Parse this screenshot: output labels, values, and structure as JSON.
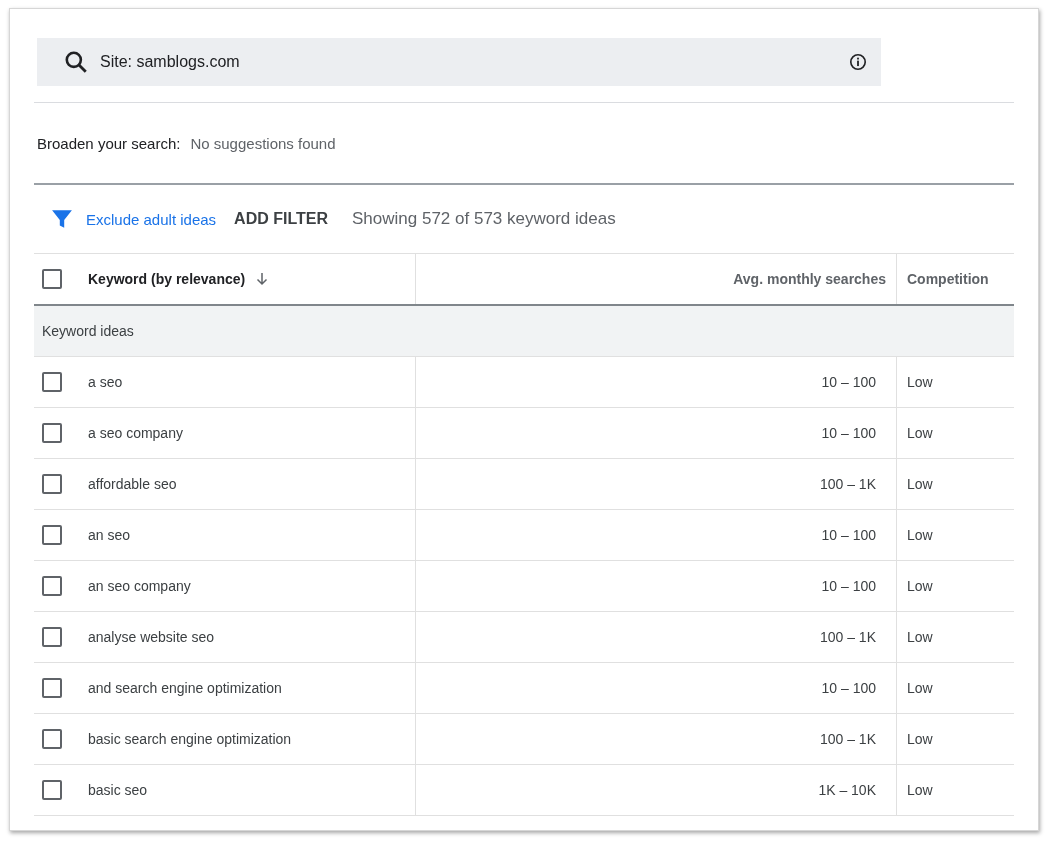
{
  "search": {
    "value": "Site: samblogs.com"
  },
  "broaden": {
    "label": "Broaden your search:",
    "value": "No suggestions found"
  },
  "filter_bar": {
    "exclude_link": "Exclude adult ideas",
    "add_filter": "ADD FILTER",
    "summary": "Showing 572 of 573 keyword ideas"
  },
  "table": {
    "select_all": {
      "checked": false
    },
    "columns": [
      "Keyword (by relevance)",
      "Avg. monthly searches",
      "Competition"
    ],
    "group": "Keyword ideas",
    "rows": [
      {
        "keyword": "a seo",
        "searches": "10 – 100",
        "competition": "Low",
        "checked": false
      },
      {
        "keyword": "a seo company",
        "searches": "10 – 100",
        "competition": "Low",
        "checked": false
      },
      {
        "keyword": "affordable seo",
        "searches": "100 – 1K",
        "competition": "Low",
        "checked": false
      },
      {
        "keyword": "an seo",
        "searches": "10 – 100",
        "competition": "Low",
        "checked": false
      },
      {
        "keyword": "an seo company",
        "searches": "10 – 100",
        "competition": "Low",
        "checked": false
      },
      {
        "keyword": "analyse website seo",
        "searches": "100 – 1K",
        "competition": "Low",
        "checked": false
      },
      {
        "keyword": "and search engine optimization",
        "searches": "10 – 100",
        "competition": "Low",
        "checked": false
      },
      {
        "keyword": "basic search engine optimization",
        "searches": "100 – 1K",
        "competition": "Low",
        "checked": false
      },
      {
        "keyword": "basic seo",
        "searches": "1K – 10K",
        "competition": "Low",
        "checked": false
      }
    ]
  }
}
